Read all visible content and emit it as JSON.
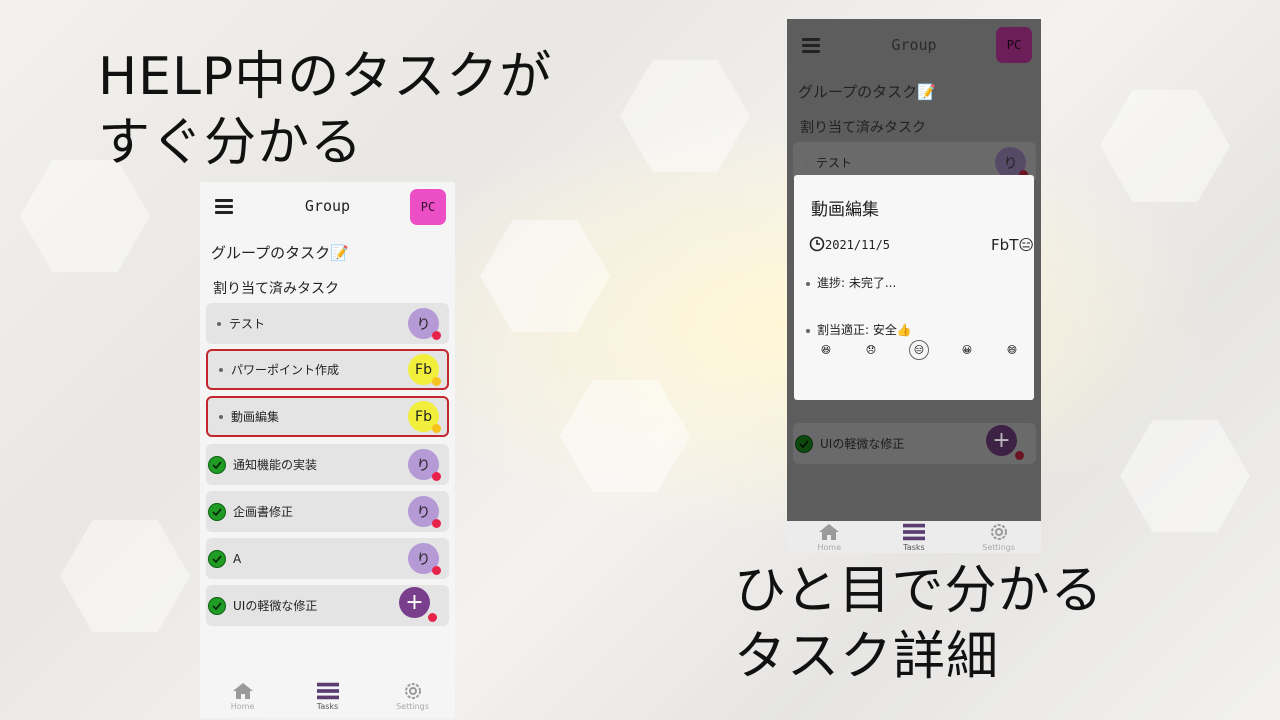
{
  "headline_left": [
    "HELP中のタスクが",
    "すぐ分かる"
  ],
  "headline_right": [
    "ひと目で分かる",
    "タスク詳細"
  ],
  "app": {
    "title": "Group",
    "user_avatar": "PC",
    "group_tasks_title": "グループのタスク📝",
    "assigned_title": "割り当て済みタスク"
  },
  "tasks": [
    {
      "label": "テスト",
      "status": "open",
      "assignee": "り",
      "help": false
    },
    {
      "label": "パワーポイント作成",
      "status": "open",
      "assignee": "Fb",
      "help": true
    },
    {
      "label": "動画編集",
      "status": "open",
      "assignee": "Fb",
      "help": true
    },
    {
      "label": "通知機能の実装",
      "status": "done",
      "assignee": "り",
      "help": false
    },
    {
      "label": "企画書修正",
      "status": "done",
      "assignee": "り",
      "help": false
    },
    {
      "label": "A",
      "status": "done",
      "assignee": "り",
      "help": false
    },
    {
      "label": "UIの軽微な修正",
      "status": "done",
      "assignee": "+",
      "help": false
    }
  ],
  "nav": {
    "home": "Home",
    "tasks": "Tasks",
    "settings": "Settings"
  },
  "detail": {
    "title": "動画編集",
    "date": "2021/11/5",
    "user": "FbT😑",
    "progress": "進捗: 未完了...",
    "assignment": "割当適正: 安全👍",
    "emojis": [
      "😆",
      "😞",
      "😑",
      "😀",
      "😄"
    ],
    "selected_emoji_index": 2
  },
  "phone2_tasks": [
    {
      "label": "テスト",
      "assignee": "り"
    },
    {
      "label": "UIの軽微な修正",
      "assignee": "+"
    }
  ],
  "colors": {
    "help_border": "#c2272d",
    "accent": "#7a3f8c",
    "done_green": "#1e9c23",
    "avatar_pink": "#ec4ec5"
  }
}
